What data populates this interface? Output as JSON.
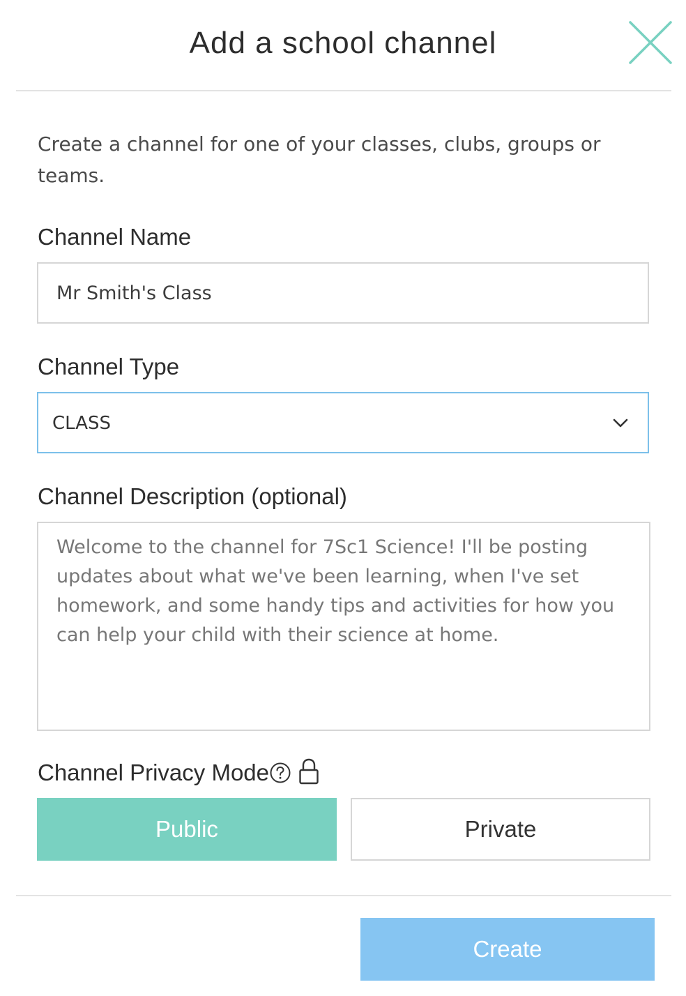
{
  "modal": {
    "title": "Add a school channel",
    "close_icon": "close-icon",
    "accent_color": "#79d1c1"
  },
  "intro": {
    "text": "Create a channel for one of your classes, clubs, groups or teams."
  },
  "channel_name": {
    "label": "Channel Name",
    "value": "Mr Smith's Class"
  },
  "channel_type": {
    "label": "Channel Type",
    "selected": "CLASS",
    "icon": "chevron-down-icon"
  },
  "channel_description": {
    "label": "Channel Description (optional)",
    "value": "Welcome to the channel for 7Sc1 Science!  I'll be posting updates about what we've been learning, when I've set homework, and some handy tips and activities for how you can help your child with their science at home."
  },
  "privacy": {
    "label": "Channel Privacy Mode",
    "help_icon": "help-circle-icon",
    "lock_icon": "lock-icon",
    "options": {
      "public": "Public",
      "private": "Private"
    },
    "selected": "Public",
    "selected_color": "#79d1c1"
  },
  "footer": {
    "create_label": "Create",
    "create_color": "#86c5f2"
  }
}
